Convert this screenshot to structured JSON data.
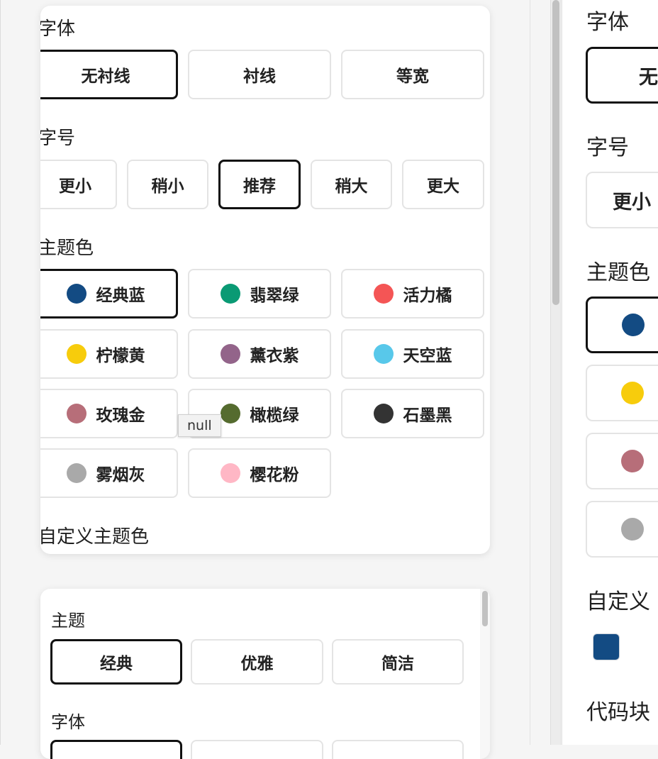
{
  "card_top": {
    "font_label": "字体",
    "font_options": [
      {
        "label": "无衬线",
        "selected": true
      },
      {
        "label": "衬线",
        "selected": false
      },
      {
        "label": "等宽",
        "selected": false
      }
    ],
    "size_label": "字号",
    "size_options": [
      {
        "label": "更小",
        "selected": false
      },
      {
        "label": "稍小",
        "selected": false
      },
      {
        "label": "推荐",
        "selected": true
      },
      {
        "label": "稍大",
        "selected": false
      },
      {
        "label": "更大",
        "selected": false
      }
    ],
    "theme_color_label": "主题色",
    "theme_colors": [
      {
        "label": "经典蓝",
        "color": "#134b83",
        "selected": true
      },
      {
        "label": "翡翠绿",
        "color": "#0a9a74",
        "selected": false
      },
      {
        "label": "活力橘",
        "color": "#f45555",
        "selected": false
      },
      {
        "label": "柠檬黄",
        "color": "#f7cc0c",
        "selected": false
      },
      {
        "label": "薰衣紫",
        "color": "#93648a",
        "selected": false
      },
      {
        "label": "天空蓝",
        "color": "#58c8ea",
        "selected": false
      },
      {
        "label": "玫瑰金",
        "color": "#b76e79",
        "selected": false
      },
      {
        "label": "橄榄绿",
        "color": "#556b2f",
        "selected": false
      },
      {
        "label": "石墨黑",
        "color": "#333333",
        "selected": false
      },
      {
        "label": "雾烟灰",
        "color": "#a9a9a9",
        "selected": false
      },
      {
        "label": "樱花粉",
        "color": "#ffb7c5",
        "selected": false
      }
    ],
    "custom_color_label": "自定义主题色",
    "tooltip": "null"
  },
  "card_bottom": {
    "theme_label": "主题",
    "theme_options": [
      {
        "label": "经典",
        "selected": true
      },
      {
        "label": "优雅",
        "selected": false
      },
      {
        "label": "简洁",
        "selected": false
      }
    ],
    "font_label": "字体"
  },
  "right_panel": {
    "font_label": "字体",
    "font_option_partial": "无",
    "size_label": "字号",
    "size_option_partial": "更小",
    "theme_color_label": "主题色",
    "theme_dots": [
      {
        "color": "#134b83",
        "selected": true
      },
      {
        "color": "#f7cc0c",
        "selected": false
      },
      {
        "color": "#b76e79",
        "selected": false
      },
      {
        "color": "#a9a9a9",
        "selected": false
      }
    ],
    "custom_label_partial": "自定义",
    "custom_swatch_color": "#134b83",
    "code_block_label_partial": "代码块"
  }
}
